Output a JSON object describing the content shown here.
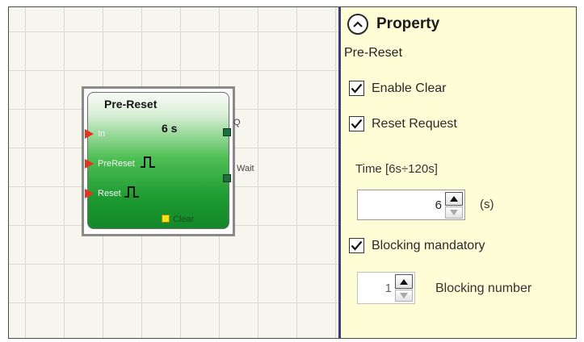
{
  "block": {
    "title": "Pre-Reset",
    "time": "6 s",
    "inputs": [
      "In",
      "PreReset",
      "Reset"
    ],
    "outputs": [
      "Q",
      "Wait"
    ],
    "clear_label": "Clear"
  },
  "panel": {
    "title": "Property",
    "block_name": "Pre-Reset",
    "enable_clear": {
      "label": "Enable Clear",
      "checked": true
    },
    "reset_request": {
      "label": "Reset Request",
      "checked": true
    },
    "time_label": "Time [6s÷120s]",
    "time_value": "6",
    "time_unit": "(s)",
    "blocking_mandatory": {
      "label": "Blocking mandatory",
      "checked": true
    },
    "blocking_number_value": "1",
    "blocking_number_label": "Blocking number"
  },
  "icons": {
    "collapse": "chevron-up-icon",
    "check": "checkmark-icon",
    "pulse": "pulse-icon"
  },
  "colors": {
    "block_green": "#1c9a30",
    "input_arrow": "#e8321f",
    "output_port": "#1f6f3e",
    "clear_port": "#f2e21a",
    "panel_bg": "#fefed6",
    "divider": "#3c3c78"
  }
}
